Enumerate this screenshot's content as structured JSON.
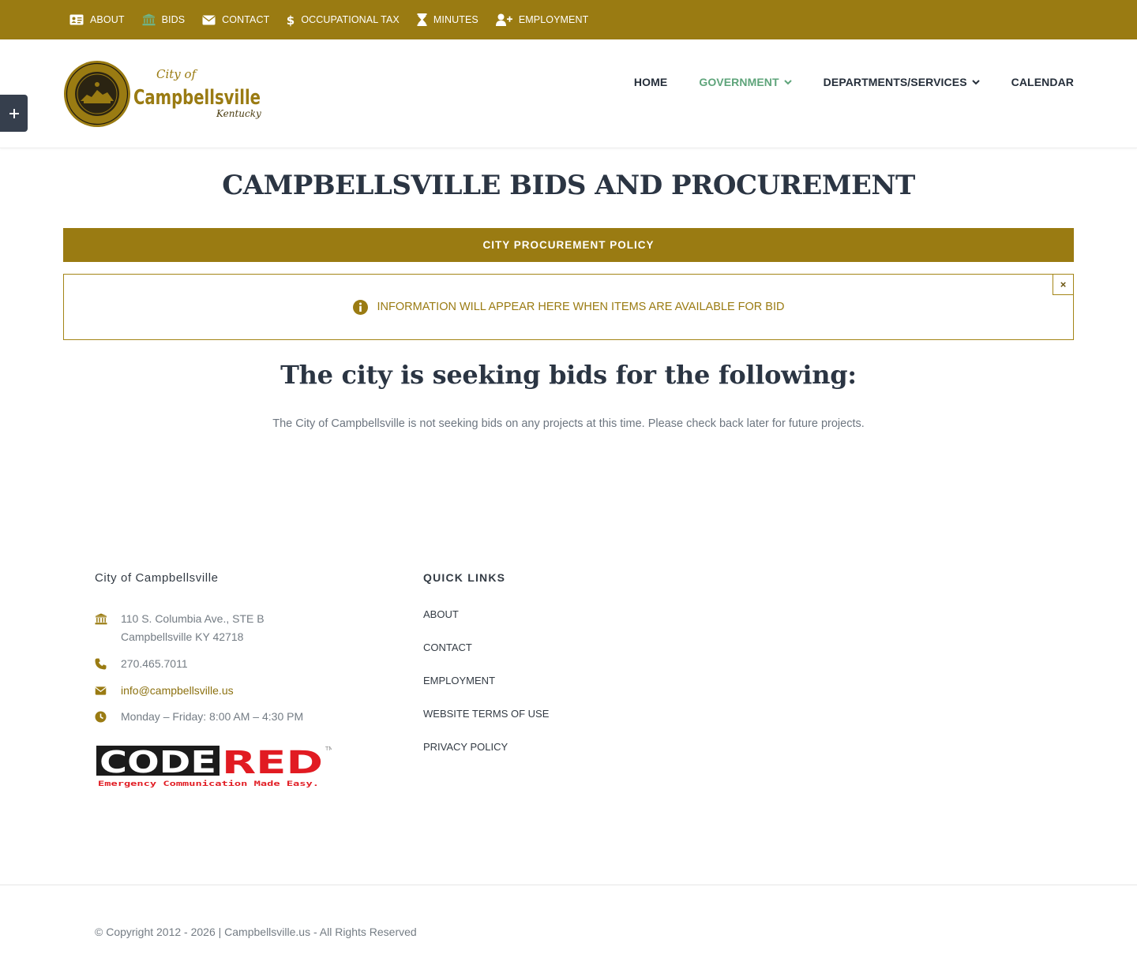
{
  "topbar": {
    "bg_color": "#9a7b12",
    "items": [
      {
        "label": "ABOUT",
        "icon": "id-card-icon"
      },
      {
        "label": "BIDS",
        "icon": "bank-icon"
      },
      {
        "label": "CONTACT",
        "icon": "envelope-icon"
      },
      {
        "label": "OCCUPATIONAL TAX",
        "icon": "dollar-icon"
      },
      {
        "label": "MINUTES",
        "icon": "hourglass-icon"
      },
      {
        "label": "EMPLOYMENT",
        "icon": "user-plus-icon"
      }
    ]
  },
  "header": {
    "logo": {
      "line1": "City of",
      "line2": "Campbellsville",
      "line3": "Kentucky"
    },
    "nav": [
      {
        "label": "HOME",
        "dropdown": false,
        "active": false
      },
      {
        "label": "GOVERNMENT",
        "dropdown": true,
        "active": true
      },
      {
        "label": "DEPARTMENTS/SERVICES",
        "dropdown": true,
        "active": false
      },
      {
        "label": "CALENDAR",
        "dropdown": false,
        "active": false
      }
    ],
    "active_color": "#5ea47a"
  },
  "main": {
    "title": "CAMPBELLSVILLE BIDS AND PROCUREMENT",
    "policy_button": "CITY PROCUREMENT POLICY",
    "alert": {
      "message": "INFORMATION WILL APPEAR HERE WHEN ITEMS ARE AVAILABLE FOR BID",
      "close": "×"
    },
    "seeking_heading": "The city is seeking bids for the following:",
    "notice": "The City of Campbellsville is not seeking bids on any projects at this time. Please check back later for future projects."
  },
  "footer": {
    "org_title": "City of Campbellsville",
    "address_line1": "110 S. Columbia Ave., STE B",
    "address_line2": "Campbellsville KY 42718",
    "phone": "270.465.7011",
    "email": "info@campbellsville.us",
    "hours": "Monday – Friday: 8:00 AM – 4:30 PM",
    "codered": {
      "word1": "CODE",
      "word2": "RED",
      "tagline": "Emergency Communication Made Easy.",
      "tm": "TM"
    },
    "quick_links_title": "QUICK LINKS",
    "quick_links": [
      "ABOUT",
      "CONTACT",
      "EMPLOYMENT",
      "WEBSITE TERMS OF USE",
      "PRIVACY POLICY"
    ],
    "copyright": "© Copyright 2012 - 2026 | Campbellsville.us - All Rights Reserved"
  }
}
